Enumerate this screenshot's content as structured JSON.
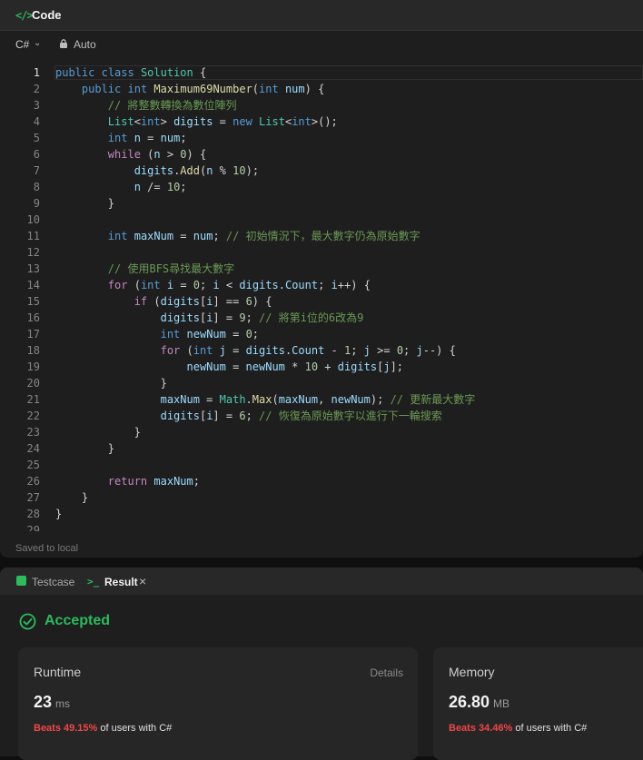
{
  "code_panel": {
    "title": "Code",
    "title_icon": "</>",
    "language": "C#",
    "autosave_label": "Auto",
    "saved_status": "Saved to local"
  },
  "code_lines": [
    [
      [
        "k",
        "public"
      ],
      [
        "p",
        " "
      ],
      [
        "k",
        "class"
      ],
      [
        "p",
        " "
      ],
      [
        "t",
        "Solution"
      ],
      [
        "p",
        " {"
      ]
    ],
    [
      [
        "p",
        "    "
      ],
      [
        "k",
        "public"
      ],
      [
        "p",
        " "
      ],
      [
        "k",
        "int"
      ],
      [
        "p",
        " "
      ],
      [
        "f",
        "Maximum69Number"
      ],
      [
        "p",
        "("
      ],
      [
        "k",
        "int"
      ],
      [
        "p",
        " "
      ],
      [
        "v",
        "num"
      ],
      [
        "p",
        ") {"
      ]
    ],
    [
      [
        "p",
        "        "
      ],
      [
        "c",
        "// 將整數轉換為數位陣列"
      ]
    ],
    [
      [
        "p",
        "        "
      ],
      [
        "t",
        "List"
      ],
      [
        "p",
        "<"
      ],
      [
        "k",
        "int"
      ],
      [
        "p",
        "> "
      ],
      [
        "v",
        "digits"
      ],
      [
        "p",
        " = "
      ],
      [
        "k",
        "new"
      ],
      [
        "p",
        " "
      ],
      [
        "t",
        "List"
      ],
      [
        "p",
        "<"
      ],
      [
        "k",
        "int"
      ],
      [
        "p",
        ">();"
      ]
    ],
    [
      [
        "p",
        "        "
      ],
      [
        "k",
        "int"
      ],
      [
        "p",
        " "
      ],
      [
        "v",
        "n"
      ],
      [
        "p",
        " = "
      ],
      [
        "v",
        "num"
      ],
      [
        "p",
        ";"
      ]
    ],
    [
      [
        "p",
        "        "
      ],
      [
        "ck",
        "while"
      ],
      [
        "p",
        " ("
      ],
      [
        "v",
        "n"
      ],
      [
        "p",
        " > "
      ],
      [
        "n",
        "0"
      ],
      [
        "p",
        ") {"
      ]
    ],
    [
      [
        "p",
        "            "
      ],
      [
        "v",
        "digits"
      ],
      [
        "p",
        "."
      ],
      [
        "f",
        "Add"
      ],
      [
        "p",
        "("
      ],
      [
        "v",
        "n"
      ],
      [
        "p",
        " % "
      ],
      [
        "n",
        "10"
      ],
      [
        "p",
        ");"
      ]
    ],
    [
      [
        "p",
        "            "
      ],
      [
        "v",
        "n"
      ],
      [
        "p",
        " /= "
      ],
      [
        "n",
        "10"
      ],
      [
        "p",
        ";"
      ]
    ],
    [
      [
        "p",
        "        }"
      ]
    ],
    [],
    [
      [
        "p",
        "        "
      ],
      [
        "k",
        "int"
      ],
      [
        "p",
        " "
      ],
      [
        "v",
        "maxNum"
      ],
      [
        "p",
        " = "
      ],
      [
        "v",
        "num"
      ],
      [
        "p",
        "; "
      ],
      [
        "c",
        "// 初始情況下，最大數字仍為原始數字"
      ]
    ],
    [],
    [
      [
        "p",
        "        "
      ],
      [
        "c",
        "// 使用BFS尋找最大數字"
      ]
    ],
    [
      [
        "p",
        "        "
      ],
      [
        "ck",
        "for"
      ],
      [
        "p",
        " ("
      ],
      [
        "k",
        "int"
      ],
      [
        "p",
        " "
      ],
      [
        "v",
        "i"
      ],
      [
        "p",
        " = "
      ],
      [
        "n",
        "0"
      ],
      [
        "p",
        "; "
      ],
      [
        "v",
        "i"
      ],
      [
        "p",
        " < "
      ],
      [
        "v",
        "digits"
      ],
      [
        "p",
        "."
      ],
      [
        "v",
        "Count"
      ],
      [
        "p",
        "; "
      ],
      [
        "v",
        "i"
      ],
      [
        "p",
        "++) {"
      ]
    ],
    [
      [
        "p",
        "            "
      ],
      [
        "ck",
        "if"
      ],
      [
        "p",
        " ("
      ],
      [
        "v",
        "digits"
      ],
      [
        "p",
        "["
      ],
      [
        "v",
        "i"
      ],
      [
        "p",
        "] == "
      ],
      [
        "n",
        "6"
      ],
      [
        "p",
        ") {"
      ]
    ],
    [
      [
        "p",
        "                "
      ],
      [
        "v",
        "digits"
      ],
      [
        "p",
        "["
      ],
      [
        "v",
        "i"
      ],
      [
        "p",
        "] = "
      ],
      [
        "n",
        "9"
      ],
      [
        "p",
        "; "
      ],
      [
        "c",
        "// 將第i位的6改為9"
      ]
    ],
    [
      [
        "p",
        "                "
      ],
      [
        "k",
        "int"
      ],
      [
        "p",
        " "
      ],
      [
        "v",
        "newNum"
      ],
      [
        "p",
        " = "
      ],
      [
        "n",
        "0"
      ],
      [
        "p",
        ";"
      ]
    ],
    [
      [
        "p",
        "                "
      ],
      [
        "ck",
        "for"
      ],
      [
        "p",
        " ("
      ],
      [
        "k",
        "int"
      ],
      [
        "p",
        " "
      ],
      [
        "v",
        "j"
      ],
      [
        "p",
        " = "
      ],
      [
        "v",
        "digits"
      ],
      [
        "p",
        "."
      ],
      [
        "v",
        "Count"
      ],
      [
        "p",
        " - "
      ],
      [
        "n",
        "1"
      ],
      [
        "p",
        "; "
      ],
      [
        "v",
        "j"
      ],
      [
        "p",
        " >= "
      ],
      [
        "n",
        "0"
      ],
      [
        "p",
        "; "
      ],
      [
        "v",
        "j"
      ],
      [
        "p",
        "--) {"
      ]
    ],
    [
      [
        "p",
        "                    "
      ],
      [
        "v",
        "newNum"
      ],
      [
        "p",
        " = "
      ],
      [
        "v",
        "newNum"
      ],
      [
        "p",
        " * "
      ],
      [
        "n",
        "10"
      ],
      [
        "p",
        " + "
      ],
      [
        "v",
        "digits"
      ],
      [
        "p",
        "["
      ],
      [
        "v",
        "j"
      ],
      [
        "p",
        "];"
      ]
    ],
    [
      [
        "p",
        "                }"
      ]
    ],
    [
      [
        "p",
        "                "
      ],
      [
        "v",
        "maxNum"
      ],
      [
        "p",
        " = "
      ],
      [
        "t",
        "Math"
      ],
      [
        "p",
        "."
      ],
      [
        "f",
        "Max"
      ],
      [
        "p",
        "("
      ],
      [
        "v",
        "maxNum"
      ],
      [
        "p",
        ", "
      ],
      [
        "v",
        "newNum"
      ],
      [
        "p",
        "); "
      ],
      [
        "c",
        "// 更新最大數字"
      ]
    ],
    [
      [
        "p",
        "                "
      ],
      [
        "v",
        "digits"
      ],
      [
        "p",
        "["
      ],
      [
        "v",
        "i"
      ],
      [
        "p",
        "] = "
      ],
      [
        "n",
        "6"
      ],
      [
        "p",
        "; "
      ],
      [
        "c",
        "// 恢復為原始數字以進行下一輪搜索"
      ]
    ],
    [
      [
        "p",
        "            }"
      ]
    ],
    [
      [
        "p",
        "        }"
      ]
    ],
    [],
    [
      [
        "p",
        "        "
      ],
      [
        "ck",
        "return"
      ],
      [
        "p",
        " "
      ],
      [
        "v",
        "maxNum"
      ],
      [
        "p",
        ";"
      ]
    ],
    [
      [
        "p",
        "    }"
      ]
    ],
    [
      [
        "p",
        "}"
      ]
    ],
    []
  ],
  "result_panel": {
    "tab_testcase": "Testcase",
    "tab_result": "Result",
    "status": "Accepted",
    "runtime": {
      "label": "Runtime",
      "details_label": "Details",
      "value": "23",
      "unit": "ms",
      "beats": "Beats 49.15%",
      "suffix": "of users with C#"
    },
    "memory": {
      "label": "Memory",
      "value": "26.80",
      "unit": "MB",
      "beats": "Beats 34.46%",
      "suffix": "of users with C#"
    }
  },
  "colors": {
    "accent_green": "#2cbb5d",
    "beats_red": "#f04747"
  }
}
